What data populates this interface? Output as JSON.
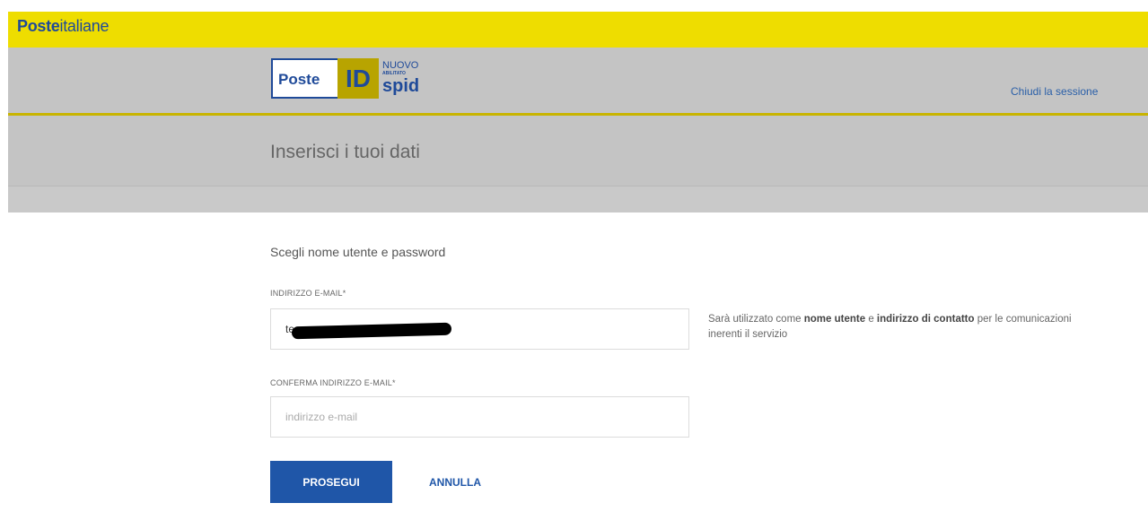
{
  "brand": {
    "name_bold": "Poste",
    "name_light": "italiane"
  },
  "header": {
    "logo": {
      "poste": "Poste",
      "id": "ID",
      "nuovo": "NUOVO",
      "abilitato": "ABILITATO",
      "spid": "spid"
    },
    "logout_label": "Chiudi la sessione"
  },
  "page_title": "Inserisci i tuoi dati",
  "form": {
    "section_heading": "Scegli nome utente e password",
    "email": {
      "label": "INDIRIZZO E-MAIL*",
      "value": "te"
    },
    "email_confirm": {
      "label": "CONFERMA INDIRIZZO E-MAIL*",
      "placeholder": "indirizzo e-mail",
      "value": ""
    },
    "helper": {
      "part1": "Sarà utilizzato come ",
      "bold1": "nome utente",
      "part2": " e ",
      "bold2": "indirizzo di contatto",
      "part3": " per le comunicazioni inerenti il servizio"
    },
    "submit_label": "PROSEGUI",
    "cancel_label": "ANNULLA"
  },
  "colors": {
    "brand_yellow": "#eedd00",
    "brand_blue": "#1f4a99",
    "button_blue": "#1f56a8",
    "header_gray": "#c4c4c4"
  }
}
